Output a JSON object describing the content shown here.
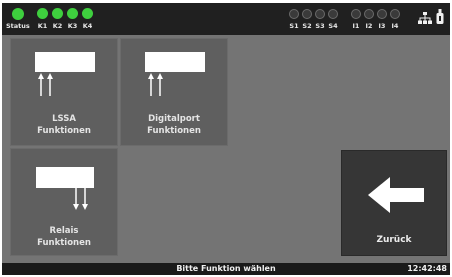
{
  "status_bar": {
    "status_label": "Status",
    "status_led": "on",
    "k_leds": [
      {
        "label": "K1",
        "state": "on"
      },
      {
        "label": "K2",
        "state": "on"
      },
      {
        "label": "K3",
        "state": "on"
      },
      {
        "label": "K4",
        "state": "on"
      }
    ],
    "s_leds": [
      {
        "label": "S1",
        "state": "off"
      },
      {
        "label": "S2",
        "state": "off"
      },
      {
        "label": "S3",
        "state": "off"
      },
      {
        "label": "S4",
        "state": "off"
      }
    ],
    "i_leds": [
      {
        "label": "I1",
        "state": "off"
      },
      {
        "label": "I2",
        "state": "off"
      },
      {
        "label": "I3",
        "state": "off"
      },
      {
        "label": "I4",
        "state": "off"
      }
    ],
    "icons": [
      "network-icon",
      "usb-icon"
    ]
  },
  "tiles": [
    {
      "line1": "LSSA",
      "line2": "Funktionen",
      "icon": "arrows-up-icon"
    },
    {
      "line1": "Digitalport",
      "line2": "Funktionen",
      "icon": "arrows-up-icon"
    },
    {
      "line1": "Relais",
      "line2": "Funktionen",
      "icon": "arrows-down-icon"
    }
  ],
  "back_button": {
    "label": "Zurück",
    "icon": "arrow-left-icon"
  },
  "bottom_bar": {
    "hint": "Bitte Funktion wählen",
    "time": "12:42:48"
  },
  "colors": {
    "led_on": "#3ecf3e",
    "background": "#747474",
    "tile": "#5f5f5f",
    "back_button": "#363636",
    "bar": "#1a1a1a"
  }
}
